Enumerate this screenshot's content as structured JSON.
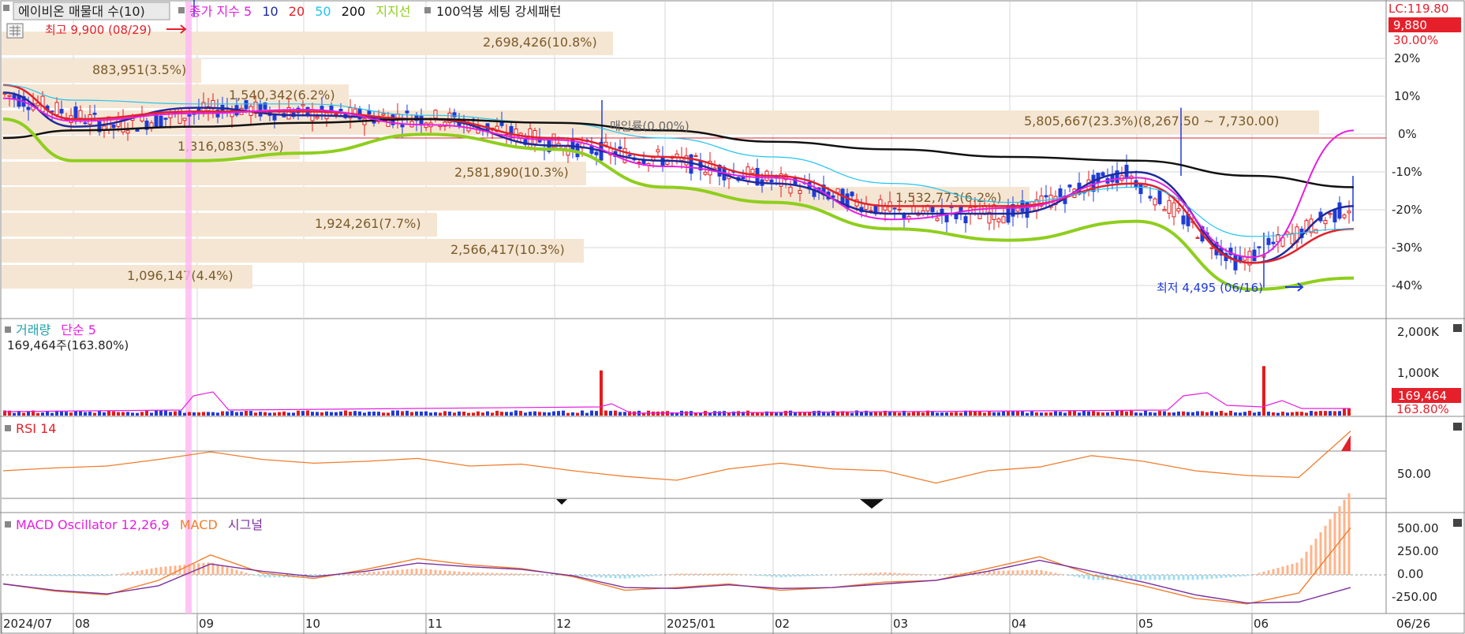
{
  "colors": {
    "up": "#e31b1b",
    "down": "#1f3bd6",
    "ma5": "#e51ee0",
    "ma10": "#1e2a9e",
    "ma20": "#e3212b",
    "ma50": "#22c5ef",
    "ma200": "#111111",
    "support": "#8fce1d",
    "rsi": "#f07d2d",
    "macd": "#f07d2d",
    "signal": "#7b2f9c",
    "osc": "#ffb38a",
    "osc_neg": "#9fdcf2",
    "grid": "#d7d7d7",
    "profile": "#f5e6d3",
    "highlight": "#ffb8f2",
    "price_badge": "#e5202a"
  },
  "header": {
    "title": "에이비온 매물대 수(10)",
    "legend": [
      {
        "text": "종가 지수 5",
        "color": "#e51ee0"
      },
      {
        "text": "10",
        "color": "#1e2a9e"
      },
      {
        "text": "20",
        "color": "#e3212b"
      },
      {
        "text": "50",
        "color": "#22c5ef"
      },
      {
        "text": "200",
        "color": "#111111"
      },
      {
        "text": "지지선",
        "color": "#8fce1d"
      }
    ],
    "setting": "100억봉 세팅 강세패턴"
  },
  "annotations": {
    "high": "최고 9,900 (08/29)",
    "low": "최저 4,495 (06/16)",
    "divest": "매입률(0.00%)",
    "lc": "LC:119.80",
    "last_price": "9,880",
    "last_change": "30.00%"
  },
  "volume_profile": [
    "2,698,426(10.8%)",
    "883,951(3.5%)",
    "1,540,342(6.2%)",
    "5,805,667(23.3%)(8,267.50 ~ 7,730.00)",
    "1,316,083(5.3%)",
    "2,581,890(10.3%)",
    "1,532,773(6.2%)",
    "1,924,261(7.7%)",
    "2,566,417(10.3%)",
    "1,096,147(4.4%)"
  ],
  "volume_panel": {
    "title": "거래량",
    "ma": "단순 5",
    "current": "169,464주(163.80%)",
    "badge_value": "169,464",
    "badge_pct": "163.80%",
    "axis": [
      "2,000K",
      "1,000K"
    ]
  },
  "rsi_panel": {
    "title": "RSI 14",
    "axis": [
      "50.00"
    ]
  },
  "macd_panel": {
    "title": "MACD Oscillator 12,26,9",
    "macd": "MACD",
    "signal": "시그널",
    "axis": [
      "500.00",
      "250.00",
      "0.00",
      "-250.00"
    ]
  },
  "xaxis": [
    "2024/07",
    "08",
    "09",
    "10",
    "11",
    "12",
    "2025/01",
    "02",
    "03",
    "04",
    "05",
    "06"
  ],
  "xaxis_right": "06/26",
  "chart_data": [
    {
      "type": "line",
      "title": "에이비온",
      "x": [
        "2024/07",
        "08",
        "09",
        "10",
        "11",
        "12",
        "2025/01",
        "02",
        "03",
        "04",
        "05",
        "06",
        "06/26"
      ],
      "y_axis_labels": [
        "30.00%",
        "20%",
        "10%",
        "0%",
        "-10%",
        "-20%",
        "-30%",
        "-40%"
      ],
      "ylim_pct": [
        -45,
        32
      ],
      "series": [
        {
          "name": "10",
          "values": [
            12,
            3,
            8,
            6,
            5,
            -2,
            -6,
            -12,
            -20,
            -20,
            -9,
            -33,
            -18
          ]
        },
        {
          "name": "20",
          "values": [
            14,
            5,
            7,
            7,
            5,
            0,
            -5,
            -10,
            -18,
            -18,
            -12,
            -33,
            -24
          ]
        },
        {
          "name": "50",
          "values": [
            14,
            10,
            9,
            9,
            6,
            4,
            0,
            -5,
            -12,
            -17,
            -13,
            -26,
            -24
          ]
        },
        {
          "name": "200",
          "values": [
            0,
            2,
            3,
            4,
            5,
            4,
            2,
            -1,
            -3,
            -5,
            -6,
            -10,
            -13
          ]
        },
        {
          "name": "지지선",
          "values": [
            5,
            -6,
            -6,
            -4,
            1,
            -3,
            -13,
            -17,
            -24,
            -27,
            -22,
            -40,
            -37
          ]
        }
      ],
      "high": {
        "value": 9900,
        "date": "08/29"
      },
      "low": {
        "value": 4495,
        "date": "06/16"
      },
      "last": 9880
    },
    {
      "type": "bar",
      "title": "거래량",
      "ylim": [
        0,
        2200000
      ],
      "spikes": [
        {
          "x": "08/29",
          "value": 1900000
        },
        {
          "x": "12",
          "value": 1050000
        },
        {
          "x": "05",
          "value": 1650000
        },
        {
          "x": "06",
          "value": 1150000
        }
      ],
      "last": 169464
    },
    {
      "type": "line",
      "title": "RSI 14",
      "ylim": [
        0,
        100
      ],
      "levels": [
        70,
        30
      ],
      "values": [
        40,
        43,
        45,
        52,
        60,
        52,
        48,
        50,
        53,
        45,
        47,
        40,
        34,
        30,
        42,
        48,
        42,
        40,
        27,
        40,
        44,
        56,
        50,
        40,
        35,
        33,
        82
      ]
    },
    {
      "type": "line",
      "title": "MACD Oscillator 12,26,9",
      "ylim": [
        -380,
        560
      ],
      "series": [
        {
          "name": "MACD",
          "values": [
            -100,
            -180,
            -220,
            -60,
            220,
            20,
            -40,
            60,
            180,
            110,
            70,
            -20,
            -170,
            -140,
            -100,
            -170,
            -140,
            -80,
            -60,
            70,
            200,
            0,
            -120,
            -260,
            -320,
            -200,
            520
          ]
        },
        {
          "name": "시그널",
          "values": [
            -100,
            -170,
            -210,
            -120,
            120,
            40,
            -20,
            40,
            130,
            90,
            60,
            -10,
            -140,
            -150,
            -110,
            -150,
            -140,
            -100,
            -60,
            40,
            160,
            40,
            -80,
            -220,
            -310,
            -300,
            -140
          ]
        }
      ]
    }
  ]
}
